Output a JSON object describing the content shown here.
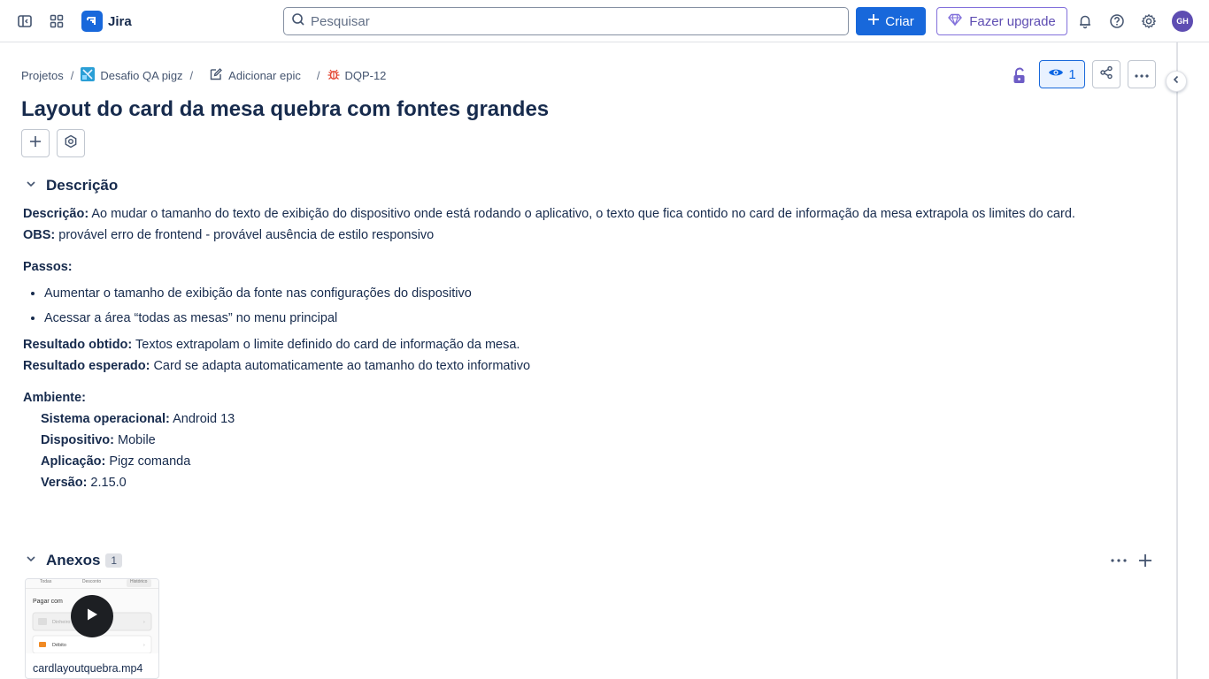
{
  "app": {
    "name": "Jira"
  },
  "search": {
    "placeholder": "Pesquisar"
  },
  "toolbar": {
    "create_label": "Criar",
    "upgrade_label": "Fazer upgrade",
    "avatar_initials": "GH"
  },
  "breadcrumb": {
    "projects": "Projetos",
    "project": "Desafio QA pigz",
    "epic": "Adicionar epic",
    "issue_key": "DQP-12"
  },
  "issue": {
    "watchers_count": "1",
    "title": "Layout do card da mesa quebra com fontes grandes"
  },
  "description": {
    "heading": "Descrição",
    "desc_label": "Descrição:",
    "desc_text": " Ao mudar o tamanho do texto de exibição do dispositivo onde está rodando o aplicativo, o texto que fica contido no card de informação da mesa extrapola os limites do card.",
    "obs_label": "OBS:",
    "obs_text": " provável erro de frontend - provável ausência de estilo responsivo",
    "steps_label": "Passos:",
    "steps": [
      "Aumentar o tamanho de exibição da fonte nas configurações do dispositivo",
      "Acessar a área “todas as mesas” no menu principal"
    ],
    "obtained_label": "Resultado obtido:",
    "obtained_text": " Textos extrapolam o limite definido do card de informação da mesa.",
    "expected_label": "Resultado esperado:",
    "expected_text": " Card se adapta automaticamente ao tamanho do texto informativo",
    "env_label": "Ambiente:",
    "env": [
      {
        "label": "Sistema operacional:",
        "value": " Android 13"
      },
      {
        "label": "Dispositivo:",
        "value": " Mobile"
      },
      {
        "label": "Aplicação:",
        "value": " Pigz comanda"
      },
      {
        "label": "Versão:",
        "value": " 2.15.0"
      }
    ]
  },
  "attachments": {
    "heading": "Anexos",
    "count": "1",
    "items": [
      {
        "filename": "cardlayoutquebra.mp4",
        "preview_tabs": [
          "Todas",
          "Desconto",
          "Histórico"
        ],
        "preview_title": "Pagar com",
        "preview_rows": [
          "Dinheiro",
          "Débito"
        ]
      }
    ]
  },
  "colors": {
    "primary": "#1868db",
    "upgrade": "#5e4db2",
    "text": "#172b4d",
    "bug": "#e34935"
  }
}
